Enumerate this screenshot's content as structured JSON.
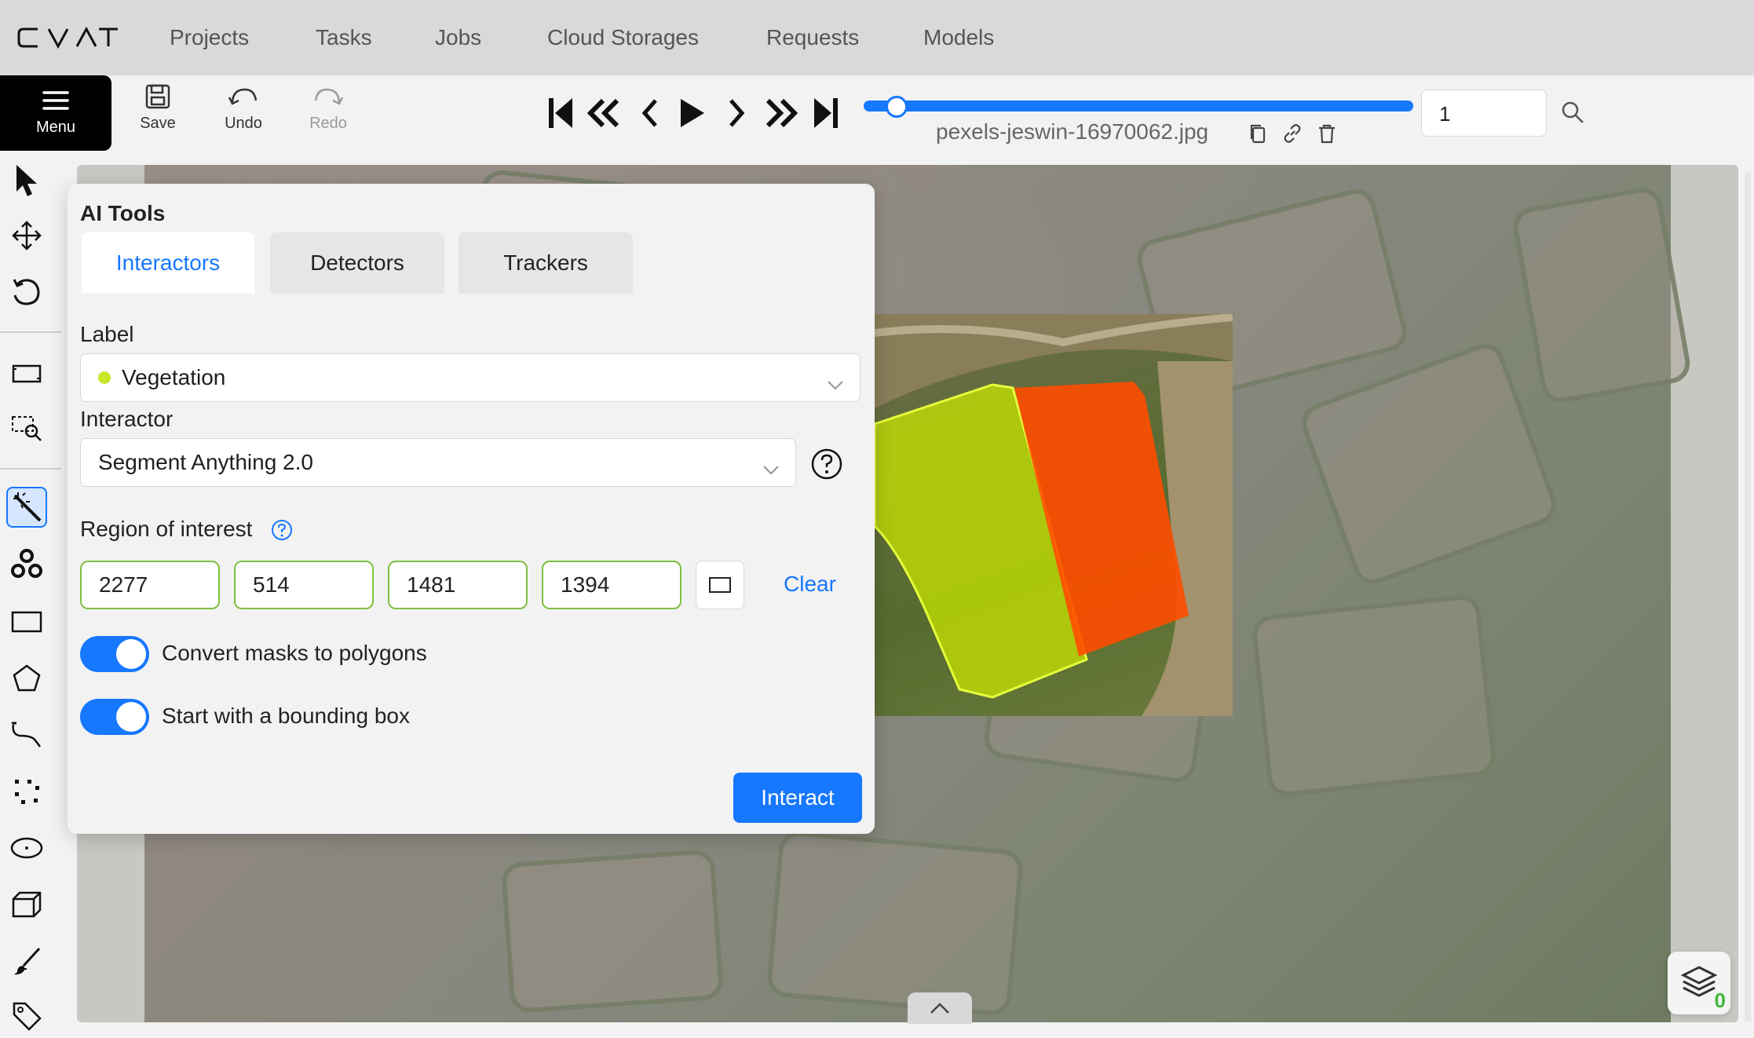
{
  "header": {
    "logo_letters": [
      "C",
      "V",
      "A",
      "T"
    ],
    "nav": [
      "Projects",
      "Tasks",
      "Jobs",
      "Cloud Storages",
      "Requests",
      "Models"
    ]
  },
  "toolbar": {
    "menu_label": "Menu",
    "save_label": "Save",
    "undo_label": "Undo",
    "redo_label": "Redo",
    "filename": "pexels-jeswin-16970062.jpg",
    "frame_number": "1",
    "player_icons": [
      "first-frame-icon",
      "backward-step-icon",
      "previous-frame-icon",
      "play-icon",
      "next-frame-icon",
      "forward-step-icon",
      "last-frame-icon"
    ],
    "file_action_icons": [
      "copy-icon",
      "link-icon",
      "delete-icon"
    ],
    "frame_slider_fraction": 0.06
  },
  "sidebar": {
    "tools": [
      "cursor-icon",
      "move-icon",
      "rotate-icon",
      "fit-image-icon",
      "zoom-region-icon",
      "ai-tools-icon",
      "opencv-icon",
      "rectangle-icon",
      "polygon-icon",
      "polyline-icon",
      "points-icon",
      "ellipse-icon",
      "cuboid-icon",
      "brush-icon",
      "tag-icon"
    ],
    "active_tool": "ai-tools-icon"
  },
  "ai_tools": {
    "title": "AI Tools",
    "tabs": [
      "Interactors",
      "Detectors",
      "Trackers"
    ],
    "active_tab": "Interactors",
    "label_caption": "Label",
    "label_value": "Vegetation",
    "label_color": "#c8e62a",
    "interactor_caption": "Interactor",
    "interactor_value": "Segment Anything 2.0",
    "roi_caption": "Region of interest",
    "roi_values": [
      "2277",
      "514",
      "1481",
      "1394"
    ],
    "clear_label": "Clear",
    "convert_masks_label": "Convert masks to polygons",
    "convert_masks_on": true,
    "bounding_box_label": "Start with a bounding box",
    "bounding_box_on": true,
    "interact_label": "Interact"
  },
  "colors": {
    "accent": "#1677ff",
    "mask_yellow": "#c8e600",
    "mask_orange": "#ff4d00",
    "roi_border": "#7ec040"
  },
  "canvas": {
    "layers_count": "0"
  }
}
